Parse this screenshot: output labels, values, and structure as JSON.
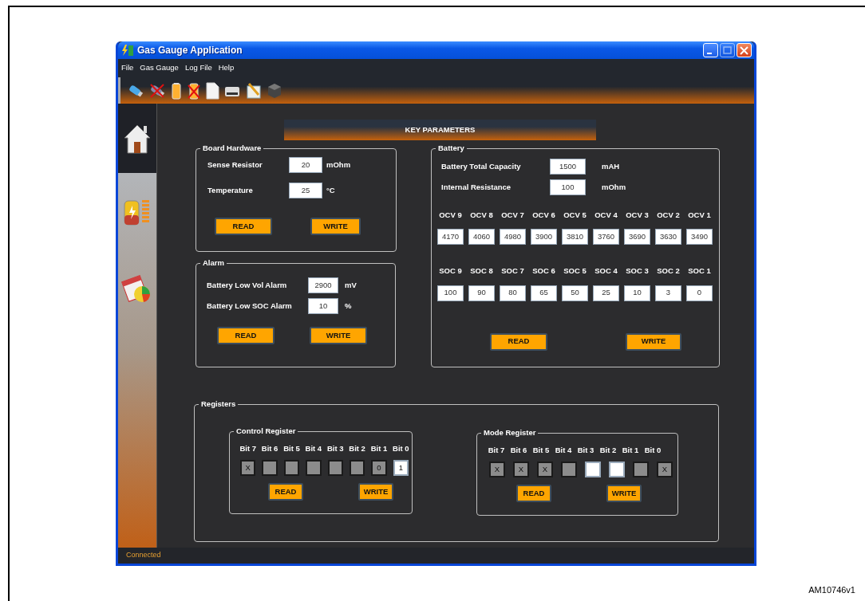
{
  "window": {
    "title": "Gas Gauge Application"
  },
  "menu": [
    "File",
    "Gas Gauge",
    "Log File",
    "Help"
  ],
  "sidebar": [
    {
      "kind": "home",
      "selected": true
    },
    {
      "kind": "battery",
      "selected": false
    },
    {
      "kind": "calendar-chart",
      "selected": false
    }
  ],
  "banner": "KEY PARAMETERS",
  "board_hardware": {
    "title": "Board Hardware",
    "fields": [
      {
        "label": "Sense Resistor",
        "value": "20",
        "unit": "mOhm"
      },
      {
        "label": "Temperature",
        "value": "25",
        "unit": "°C"
      }
    ],
    "buttons": [
      "READ",
      "WRITE"
    ]
  },
  "alarm": {
    "title": "Alarm",
    "fields": [
      {
        "label": "Battery Low Vol Alarm",
        "value": "2900",
        "unit": "mV"
      },
      {
        "label": "Battery Low SOC Alarm",
        "value": "10",
        "unit": "%"
      }
    ],
    "buttons": [
      "READ",
      "WRITE"
    ]
  },
  "battery": {
    "title": "Battery",
    "fields": [
      {
        "label": "Battery Total Capacity",
        "value": "1500",
        "unit": "mAH"
      },
      {
        "label": "Internal Resistance",
        "value": "100",
        "unit": "mOhm"
      }
    ],
    "ocv": [
      {
        "label": "OCV 9",
        "value": "4170"
      },
      {
        "label": "OCV 8",
        "value": "4060"
      },
      {
        "label": "OCV 7",
        "value": "4980"
      },
      {
        "label": "OCV 6",
        "value": "3900"
      },
      {
        "label": "OCV 5",
        "value": "3810"
      },
      {
        "label": "OCV 4",
        "value": "3760"
      },
      {
        "label": "OCV 3",
        "value": "3690"
      },
      {
        "label": "OCV 2",
        "value": "3630"
      },
      {
        "label": "OCV 1",
        "value": "3490"
      }
    ],
    "soc": [
      {
        "label": "SOC 9",
        "value": "100"
      },
      {
        "label": "SOC 8",
        "value": "90"
      },
      {
        "label": "SOC 7",
        "value": "80"
      },
      {
        "label": "SOC 6",
        "value": "65"
      },
      {
        "label": "SOC 5",
        "value": "50"
      },
      {
        "label": "SOC 4",
        "value": "25"
      },
      {
        "label": "SOC 3",
        "value": "10"
      },
      {
        "label": "SOC 2",
        "value": "3"
      },
      {
        "label": "SOC 1",
        "value": "0"
      }
    ],
    "buttons": [
      "READ",
      "WRITE"
    ]
  },
  "registers": {
    "title": "Registers",
    "groups": [
      {
        "title": "Control Register",
        "bits": [
          {
            "label": "Bit 7",
            "value": "X",
            "disabled": true
          },
          {
            "label": "Bit 6",
            "disabled": true
          },
          {
            "label": "Bit 5",
            "disabled": true
          },
          {
            "label": "Bit 4",
            "disabled": true
          },
          {
            "label": "Bit 3",
            "disabled": true
          },
          {
            "label": "Bit 2",
            "disabled": true
          },
          {
            "label": "Bit 1",
            "value": "0",
            "disabled": true
          },
          {
            "label": "Bit 0",
            "value": "1",
            "disabled": false
          }
        ],
        "buttons": [
          "READ",
          "WRITE"
        ]
      },
      {
        "title": "Mode Register",
        "bits": [
          {
            "label": "Bit 7",
            "value": "X",
            "disabled": true
          },
          {
            "label": "Bit 6",
            "value": "X",
            "disabled": true
          },
          {
            "label": "Bit 5",
            "value": "X",
            "disabled": true
          },
          {
            "label": "Bit 4",
            "disabled": true
          },
          {
            "label": "Bit 3",
            "disabled": false
          },
          {
            "label": "Bit 2",
            "disabled": false
          },
          {
            "label": "Bit 1",
            "disabled": true
          },
          {
            "label": "Bit 0",
            "value": "X",
            "disabled": true
          }
        ],
        "buttons": [
          "READ",
          "WRITE"
        ]
      }
    ]
  },
  "status_bar": "Connected",
  "figure_code": "AM10746v1"
}
